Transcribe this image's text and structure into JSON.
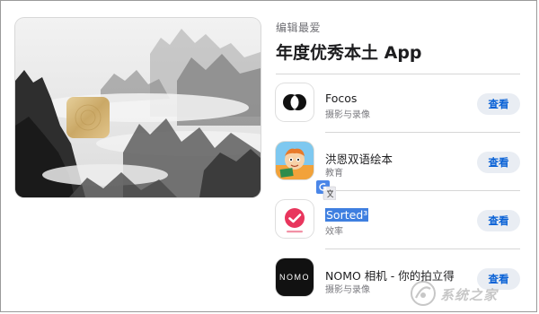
{
  "section": {
    "eyebrow": "编辑最爱",
    "title": "年度优秀本土 App"
  },
  "apps": [
    {
      "name": "Focos",
      "category": "摄影与录像",
      "button": "查看",
      "icon": "focos-icon"
    },
    {
      "name": "洪恩双语绘本",
      "category": "教育",
      "button": "查看",
      "icon": "hongen-bilingual-book-icon"
    },
    {
      "name": "Sorted³",
      "category": "效率",
      "button": "查看",
      "icon": "sorted-icon"
    },
    {
      "name": "NOMO 相机 - 你的拍立得",
      "category": "摄影与录像",
      "button": "查看",
      "icon": "nomo-icon"
    }
  ],
  "nomo_icon_text": "NOMO",
  "watermark": {
    "text": "系统之家"
  },
  "colors": {
    "accent": "#0a62d6",
    "button_bg": "#e9edf3",
    "selection": "#3f7fe0",
    "sorted_red": "#e8365d"
  }
}
